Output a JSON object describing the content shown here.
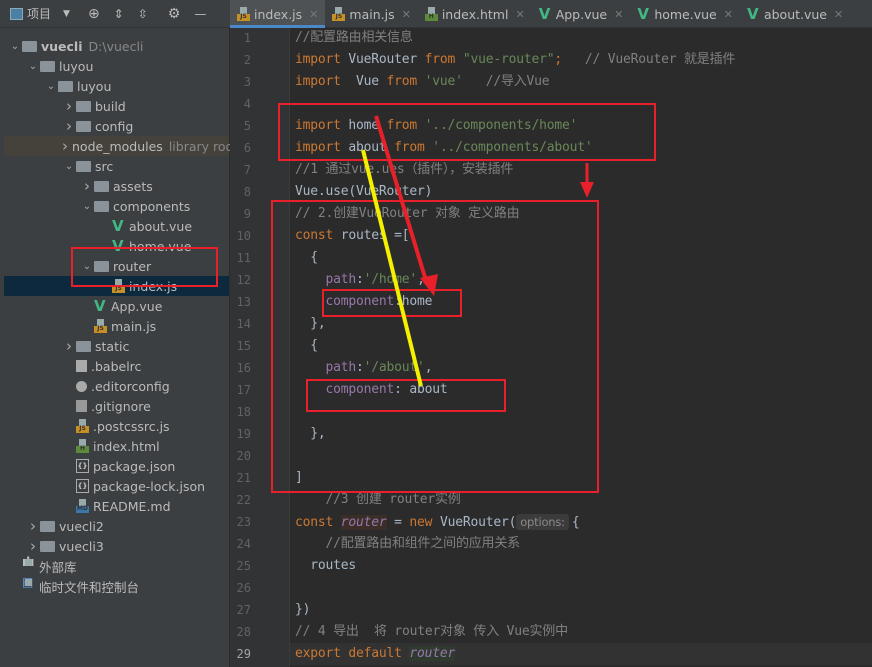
{
  "toolbar": {
    "project_label": "项目",
    "icons": [
      "project-view-icon",
      "dropdown-icon",
      "locate-icon",
      "expand-all-icon",
      "collapse-all-icon",
      "gear-icon",
      "minimize-icon"
    ]
  },
  "tabs": [
    {
      "label": "index.js",
      "icon": "js",
      "active": true
    },
    {
      "label": "main.js",
      "icon": "js"
    },
    {
      "label": "index.html",
      "icon": "html"
    },
    {
      "label": "App.vue",
      "icon": "vue"
    },
    {
      "label": "home.vue",
      "icon": "vue"
    },
    {
      "label": "about.vue",
      "icon": "vue"
    }
  ],
  "tree": [
    {
      "label": "vuecli",
      "hint": "D:\\vuecli",
      "level": 0,
      "icon": "folder",
      "arrow": "open",
      "bold": true
    },
    {
      "label": "luyou",
      "level": 1,
      "icon": "folder",
      "arrow": "open"
    },
    {
      "label": "luyou",
      "level": 2,
      "icon": "folder",
      "arrow": "open"
    },
    {
      "label": "build",
      "level": 3,
      "icon": "folder",
      "arrow": "closed"
    },
    {
      "label": "config",
      "level": 3,
      "icon": "folder",
      "arrow": "closed"
    },
    {
      "label": "node_modules",
      "hint": "library root",
      "level": 3,
      "icon": "folder",
      "arrow": "closed",
      "lib": true
    },
    {
      "label": "src",
      "level": 3,
      "icon": "folder",
      "arrow": "open"
    },
    {
      "label": "assets",
      "level": 4,
      "icon": "folder",
      "arrow": "closed"
    },
    {
      "label": "components",
      "level": 4,
      "icon": "folder",
      "arrow": "open"
    },
    {
      "label": "about.vue",
      "level": 5,
      "icon": "vue"
    },
    {
      "label": "home.vue",
      "level": 5,
      "icon": "vue"
    },
    {
      "label": "router",
      "level": 4,
      "icon": "folder",
      "arrow": "open"
    },
    {
      "label": "index.js",
      "level": 5,
      "icon": "js",
      "selected": true
    },
    {
      "label": "App.vue",
      "level": 4,
      "icon": "vue"
    },
    {
      "label": "main.js",
      "level": 4,
      "icon": "js"
    },
    {
      "label": "static",
      "level": 3,
      "icon": "folder",
      "arrow": "closed"
    },
    {
      "label": ".babelrc",
      "level": 3,
      "icon": "babel"
    },
    {
      "label": ".editorconfig",
      "level": 3,
      "icon": "cfg"
    },
    {
      "label": ".gitignore",
      "level": 3,
      "icon": "git"
    },
    {
      "label": ".postcssrc.js",
      "level": 3,
      "icon": "js"
    },
    {
      "label": "index.html",
      "level": 3,
      "icon": "html"
    },
    {
      "label": "package.json",
      "level": 3,
      "icon": "json"
    },
    {
      "label": "package-lock.json",
      "level": 3,
      "icon": "json"
    },
    {
      "label": "README.md",
      "level": 3,
      "icon": "md"
    },
    {
      "label": "vuecli2",
      "level": 1,
      "icon": "folder",
      "arrow": "closed"
    },
    {
      "label": "vuecli3",
      "level": 1,
      "icon": "folder",
      "arrow": "closed"
    },
    {
      "label": "外部库",
      "level": 0,
      "icon": "library"
    },
    {
      "label": "临时文件和控制台",
      "level": 0,
      "icon": "console"
    }
  ],
  "current_line": 29,
  "code": [
    [
      [
        "//配置路由相关信息",
        "cm"
      ]
    ],
    [
      [
        "import ",
        "kw"
      ],
      [
        "VueRouter "
      ],
      [
        "from ",
        "kw"
      ],
      [
        "\"vue-router\"",
        "str"
      ],
      [
        ";",
        "kw"
      ],
      [
        "   // VueRouter 就是插件",
        "cm"
      ]
    ],
    [
      [
        "import ",
        "kw"
      ],
      [
        " Vue "
      ],
      [
        "from ",
        "kw"
      ],
      [
        "'vue'",
        "str"
      ],
      [
        "   //导入Vue",
        "cm"
      ]
    ],
    [],
    [
      [
        "import ",
        "kw"
      ],
      [
        "home "
      ],
      [
        "from ",
        "kw"
      ],
      [
        "'../components/home'",
        "str"
      ]
    ],
    [
      [
        "import ",
        "kw"
      ],
      [
        "about "
      ],
      [
        "from ",
        "kw"
      ],
      [
        "'../components/about'",
        "str"
      ]
    ],
    [
      [
        "//1 通过vue.ues（插件），安装插件",
        "cm"
      ]
    ],
    [
      [
        "Vue.use(VueRouter)"
      ]
    ],
    [
      [
        "// 2.创建VueRouter 对象 定义路由",
        "cm"
      ]
    ],
    [
      [
        "const ",
        "kw"
      ],
      [
        "routes =["
      ]
    ],
    [
      [
        "  {"
      ]
    ],
    [
      [
        "    "
      ],
      [
        "path",
        "prop"
      ],
      [
        ":"
      ],
      [
        "'/home'",
        "str"
      ],
      [
        ","
      ]
    ],
    [
      [
        "    "
      ],
      [
        "component",
        "prop"
      ],
      [
        ":home"
      ]
    ],
    [
      [
        "  },"
      ]
    ],
    [
      [
        "  {"
      ]
    ],
    [
      [
        "    "
      ],
      [
        "path",
        "prop"
      ],
      [
        ":"
      ],
      [
        "'/about'",
        "str"
      ],
      [
        ","
      ]
    ],
    [
      [
        "    "
      ],
      [
        "component",
        "prop"
      ],
      [
        ": about"
      ]
    ],
    [],
    [
      [
        "  },"
      ]
    ],
    [],
    [
      [
        "]"
      ]
    ],
    [
      [
        "    //3 创建 router实例",
        "cm"
      ]
    ],
    [
      [
        "const ",
        "kw"
      ],
      [
        "router",
        "var hl1"
      ],
      [
        " = "
      ],
      [
        "new ",
        "kw"
      ],
      [
        "VueRouter("
      ],
      [
        "options:",
        "hint"
      ],
      [
        "{"
      ]
    ],
    [
      [
        "    //配置路由和组件之间的应用关系",
        "cm"
      ]
    ],
    [
      [
        "  routes"
      ]
    ],
    [],
    [
      [
        "})"
      ]
    ],
    [
      [
        "// 4 导出  将 router对象 传入 Vue实例中",
        "cm"
      ]
    ],
    [
      [
        "export ",
        "kw"
      ],
      [
        "default ",
        "kw"
      ],
      [
        "router",
        "var hl2"
      ]
    ]
  ],
  "annotation_colors": {
    "box": "#e8202a",
    "arrow_red": "#e8202a",
    "arrow_yellow": "#f4f000"
  }
}
